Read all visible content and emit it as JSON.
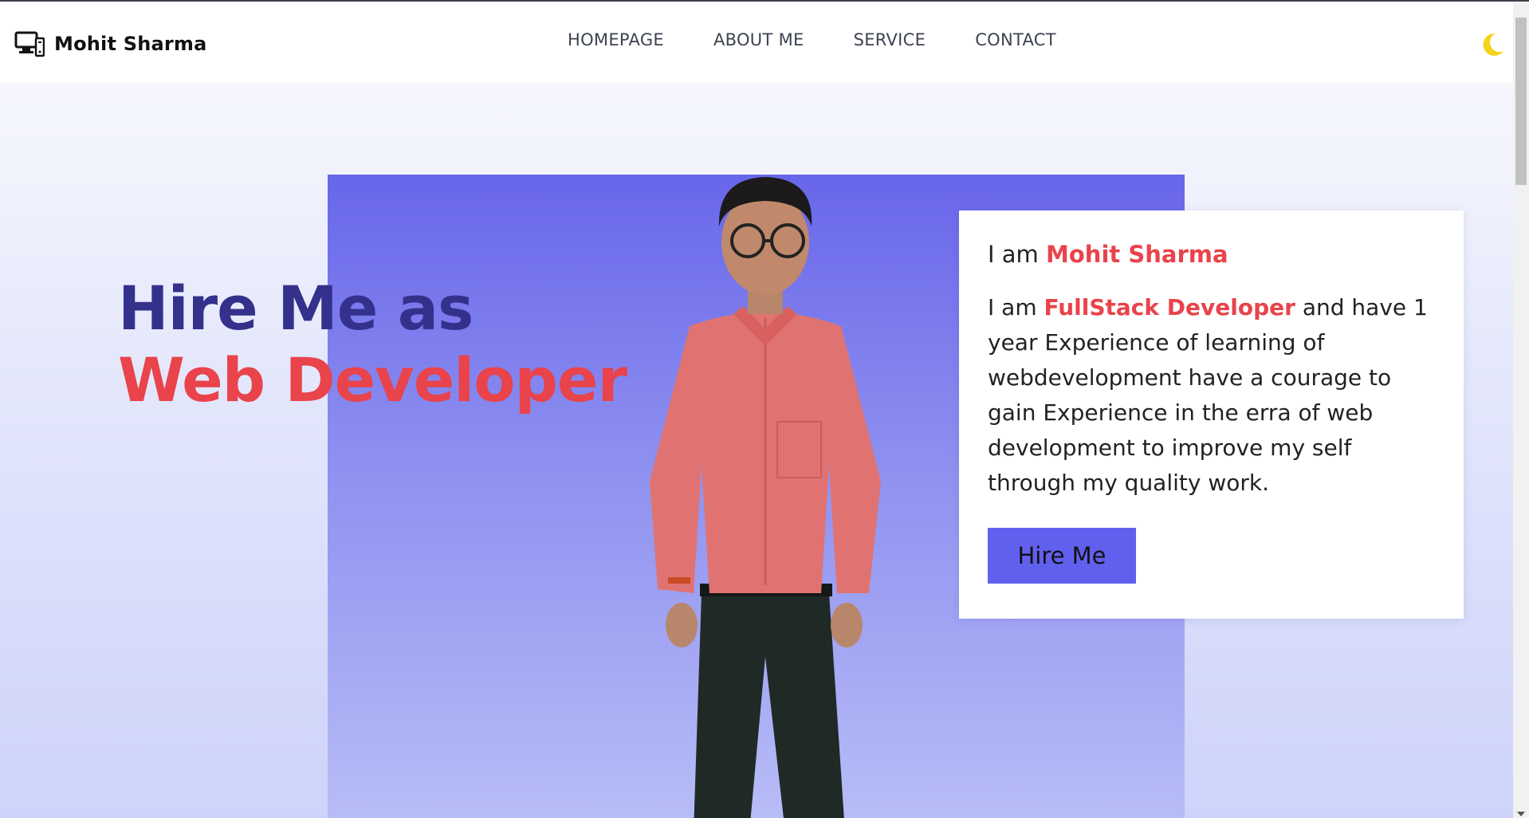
{
  "header": {
    "brand_name": "Mohit Sharma",
    "brand_icon": "computer-icon",
    "nav": [
      {
        "label": "HOMEPAGE"
      },
      {
        "label": "ABOUT ME"
      },
      {
        "label": "SERVICE"
      },
      {
        "label": "CONTACT"
      }
    ],
    "theme_icon": "moon-icon"
  },
  "hero": {
    "title_line1": "Hire Me as",
    "title_line2": "Web Developer",
    "card": {
      "intro_prefix": "I am ",
      "intro_name": "Mohit Sharma",
      "desc_prefix": "I am ",
      "desc_role": "FullStack Developer",
      "desc_rest": " and have 1 year Experience of learning of webdevelopment have a courage to gain Experience in the erra of web development to improve my self through my quality work.",
      "button_label": "Hire Me"
    }
  },
  "colors": {
    "accent_red": "#e9434b",
    "title_navy": "#34318c",
    "purple": "#6866ea",
    "button": "#6160ee",
    "moon": "#f5d31a"
  }
}
